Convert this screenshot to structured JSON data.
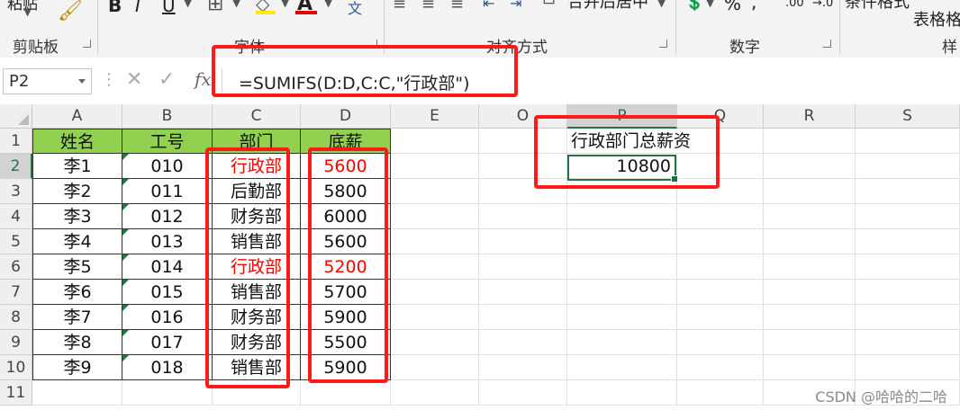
{
  "ribbon": {
    "clipboard_group": "剪贴板",
    "clipboard_paste_partial": "粘贴",
    "font_group": "字体",
    "align_group": "对齐方式",
    "merge_center": "合并后居中",
    "number_group": "数字",
    "percent": "%",
    "comma": ",",
    "inc_decimal": ".00",
    "dec_decimal": "→.0",
    "cond_format_partial": "条件格式",
    "table_format_partial": "表格格",
    "styles_partial": "样",
    "font_bold": "B",
    "font_italic": "I",
    "font_underline": "U",
    "font_color": "A",
    "phonetic": "文"
  },
  "formula_bar": {
    "name_box": "P2",
    "formula": "=SUMIFS(D:D,C:C,\"行政部\")"
  },
  "columns": [
    "A",
    "B",
    "C",
    "D",
    "E",
    "O",
    "P",
    "Q",
    "R",
    "S"
  ],
  "rows": [
    "1",
    "2",
    "3",
    "4",
    "5",
    "6",
    "7",
    "8",
    "9",
    "10",
    "11"
  ],
  "table": {
    "headers": [
      "姓名",
      "工号",
      "部门",
      "底薪"
    ],
    "rows": [
      [
        "李1",
        "010",
        "行政部",
        "5600"
      ],
      [
        "李2",
        "011",
        "后勤部",
        "5800"
      ],
      [
        "李3",
        "012",
        "财务部",
        "6000"
      ],
      [
        "李4",
        "013",
        "销售部",
        "5600"
      ],
      [
        "李5",
        "014",
        "行政部",
        "5200"
      ],
      [
        "李6",
        "015",
        "销售部",
        "5700"
      ],
      [
        "李7",
        "016",
        "财务部",
        "5900"
      ],
      [
        "李8",
        "017",
        "财务部",
        "5500"
      ],
      [
        "李9",
        "018",
        "销售部",
        "5900"
      ]
    ]
  },
  "result": {
    "label": "行政部门总薪资",
    "value": "10800"
  },
  "watermark": "CSDN @哈哈的二哈",
  "colors": {
    "header_fill": "#92d050",
    "highlight_red": "#ff0000",
    "selection_green": "#217346"
  }
}
